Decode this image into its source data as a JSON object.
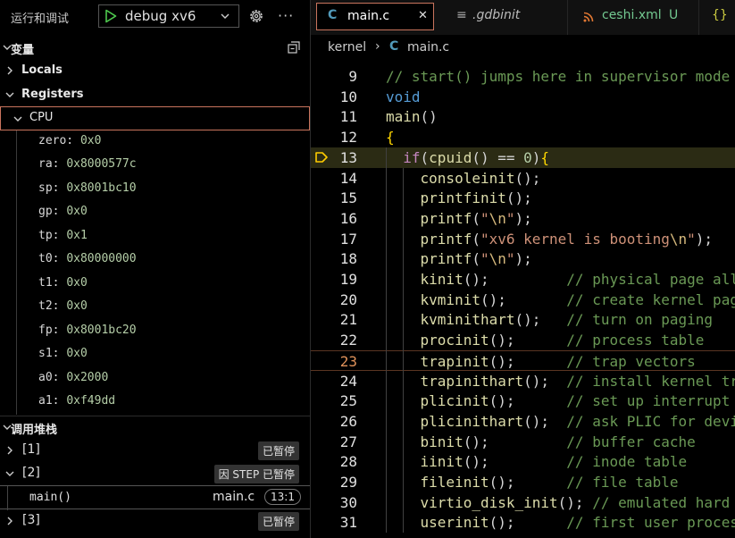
{
  "run_panel": {
    "title": "运行和调试",
    "config": "debug xv6"
  },
  "variables": {
    "header": "变量",
    "locals": "Locals",
    "registers": "Registers",
    "cpu": "CPU",
    "regs": [
      {
        "name": "zero:",
        "value": "0x0"
      },
      {
        "name": "ra:",
        "value": "0x8000577c"
      },
      {
        "name": "sp:",
        "value": "0x8001bc10"
      },
      {
        "name": "gp:",
        "value": "0x0"
      },
      {
        "name": "tp:",
        "value": "0x1"
      },
      {
        "name": "t0:",
        "value": "0x80000000"
      },
      {
        "name": "t1:",
        "value": "0x0"
      },
      {
        "name": "t2:",
        "value": "0x0"
      },
      {
        "name": "fp:",
        "value": "0x8001bc20"
      },
      {
        "name": "s1:",
        "value": "0x0"
      },
      {
        "name": "a0:",
        "value": "0x2000"
      },
      {
        "name": "a1:",
        "value": "0xf49dd"
      }
    ]
  },
  "call_stack": {
    "header": "调用堆栈",
    "threads": [
      {
        "label": "[1]",
        "status": "已暂停"
      },
      {
        "label": "[2]",
        "status": "因 STEP 已暂停"
      },
      {
        "label": "[3]",
        "status": "已暂停"
      }
    ],
    "frame": {
      "function": "main()",
      "file": "main.c",
      "position": "13:1"
    }
  },
  "tabs": [
    {
      "icon": "C",
      "label": "main.c",
      "close": "✕"
    },
    {
      "icon": "≡",
      "label": ".gdbinit"
    },
    {
      "icon": "rss",
      "label": "ceshi.xml",
      "status": "U"
    },
    {
      "icon": "{}",
      "label": ""
    }
  ],
  "breadcrumb": {
    "folder": "kernel",
    "sep": "›",
    "file_icon": "C",
    "file": "main.c"
  },
  "code": {
    "current_line": 23,
    "breakpoint_line": 13,
    "lines": [
      {
        "n": "9",
        "tokens": [
          [
            "cmt",
            "// start() jumps here in supervisor mode on all CPUs."
          ]
        ]
      },
      {
        "n": "10",
        "tokens": [
          [
            "kw",
            "void"
          ]
        ]
      },
      {
        "n": "11",
        "tokens": [
          [
            "fn",
            "main"
          ],
          [
            "pun",
            "()"
          ]
        ]
      },
      {
        "n": "12",
        "tokens": [
          [
            "br",
            "{"
          ]
        ]
      },
      {
        "n": "13",
        "tokens": [
          [
            "pun",
            "  "
          ],
          [
            "ctl",
            "if"
          ],
          [
            "pun",
            "("
          ],
          [
            "fn",
            "cpuid"
          ],
          [
            "pun",
            "() == "
          ],
          [
            "num",
            "0"
          ],
          [
            "pun",
            ")"
          ],
          [
            "br",
            "{"
          ]
        ]
      },
      {
        "n": "14",
        "tokens": [
          [
            "pun",
            "    "
          ],
          [
            "fn",
            "consoleinit"
          ],
          [
            "pun",
            "();"
          ]
        ]
      },
      {
        "n": "15",
        "tokens": [
          [
            "pun",
            "    "
          ],
          [
            "fn",
            "printfinit"
          ],
          [
            "pun",
            "();"
          ]
        ]
      },
      {
        "n": "16",
        "tokens": [
          [
            "pun",
            "    "
          ],
          [
            "fn",
            "printf"
          ],
          [
            "pun",
            "("
          ],
          [
            "str",
            "\""
          ],
          [
            "esc",
            "\\n"
          ],
          [
            "str",
            "\""
          ],
          [
            "pun",
            ");"
          ]
        ]
      },
      {
        "n": "17",
        "tokens": [
          [
            "pun",
            "    "
          ],
          [
            "fn",
            "printf"
          ],
          [
            "pun",
            "("
          ],
          [
            "str",
            "\"xv6 kernel is booting"
          ],
          [
            "esc",
            "\\n"
          ],
          [
            "str",
            "\""
          ],
          [
            "pun",
            ");"
          ]
        ]
      },
      {
        "n": "18",
        "tokens": [
          [
            "pun",
            "    "
          ],
          [
            "fn",
            "printf"
          ],
          [
            "pun",
            "("
          ],
          [
            "str",
            "\""
          ],
          [
            "esc",
            "\\n"
          ],
          [
            "str",
            "\""
          ],
          [
            "pun",
            ");"
          ]
        ]
      },
      {
        "n": "19",
        "tokens": [
          [
            "pun",
            "    "
          ],
          [
            "fn",
            "kinit"
          ],
          [
            "pun",
            "();         "
          ],
          [
            "cmt",
            "// physical page allocator"
          ]
        ]
      },
      {
        "n": "20",
        "tokens": [
          [
            "pun",
            "    "
          ],
          [
            "fn",
            "kvminit"
          ],
          [
            "pun",
            "();       "
          ],
          [
            "cmt",
            "// create kernel page table"
          ]
        ]
      },
      {
        "n": "21",
        "tokens": [
          [
            "pun",
            "    "
          ],
          [
            "fn",
            "kvminithart"
          ],
          [
            "pun",
            "();   "
          ],
          [
            "cmt",
            "// turn on paging"
          ]
        ]
      },
      {
        "n": "22",
        "tokens": [
          [
            "pun",
            "    "
          ],
          [
            "fn",
            "procinit"
          ],
          [
            "pun",
            "();      "
          ],
          [
            "cmt",
            "// process table"
          ]
        ]
      },
      {
        "n": "23",
        "tokens": [
          [
            "pun",
            "    "
          ],
          [
            "fn",
            "trapinit"
          ],
          [
            "pun",
            "();      "
          ],
          [
            "cmt",
            "// trap vectors"
          ]
        ]
      },
      {
        "n": "24",
        "tokens": [
          [
            "pun",
            "    "
          ],
          [
            "fn",
            "trapinithart"
          ],
          [
            "pun",
            "();  "
          ],
          [
            "cmt",
            "// install kernel trap vector"
          ]
        ]
      },
      {
        "n": "25",
        "tokens": [
          [
            "pun",
            "    "
          ],
          [
            "fn",
            "plicinit"
          ],
          [
            "pun",
            "();      "
          ],
          [
            "cmt",
            "// set up interrupt controller"
          ]
        ]
      },
      {
        "n": "26",
        "tokens": [
          [
            "pun",
            "    "
          ],
          [
            "fn",
            "plicinithart"
          ],
          [
            "pun",
            "();  "
          ],
          [
            "cmt",
            "// ask PLIC for device interrupts"
          ]
        ]
      },
      {
        "n": "27",
        "tokens": [
          [
            "pun",
            "    "
          ],
          [
            "fn",
            "binit"
          ],
          [
            "pun",
            "();         "
          ],
          [
            "cmt",
            "// buffer cache"
          ]
        ]
      },
      {
        "n": "28",
        "tokens": [
          [
            "pun",
            "    "
          ],
          [
            "fn",
            "iinit"
          ],
          [
            "pun",
            "();         "
          ],
          [
            "cmt",
            "// inode table"
          ]
        ]
      },
      {
        "n": "29",
        "tokens": [
          [
            "pun",
            "    "
          ],
          [
            "fn",
            "fileinit"
          ],
          [
            "pun",
            "();      "
          ],
          [
            "cmt",
            "// file table"
          ]
        ]
      },
      {
        "n": "30",
        "tokens": [
          [
            "pun",
            "    "
          ],
          [
            "fn",
            "virtio_disk_init"
          ],
          [
            "pun",
            "(); "
          ],
          [
            "cmt",
            "// emulated hard disk"
          ]
        ]
      },
      {
        "n": "31",
        "tokens": [
          [
            "pun",
            "    "
          ],
          [
            "fn",
            "userinit"
          ],
          [
            "pun",
            "();      "
          ],
          [
            "cmt",
            "// first user process"
          ]
        ]
      }
    ]
  },
  "colors": {
    "accent": "#c9745d",
    "debug_line": "#2b2b14",
    "current_line_number": "#e0925a"
  }
}
